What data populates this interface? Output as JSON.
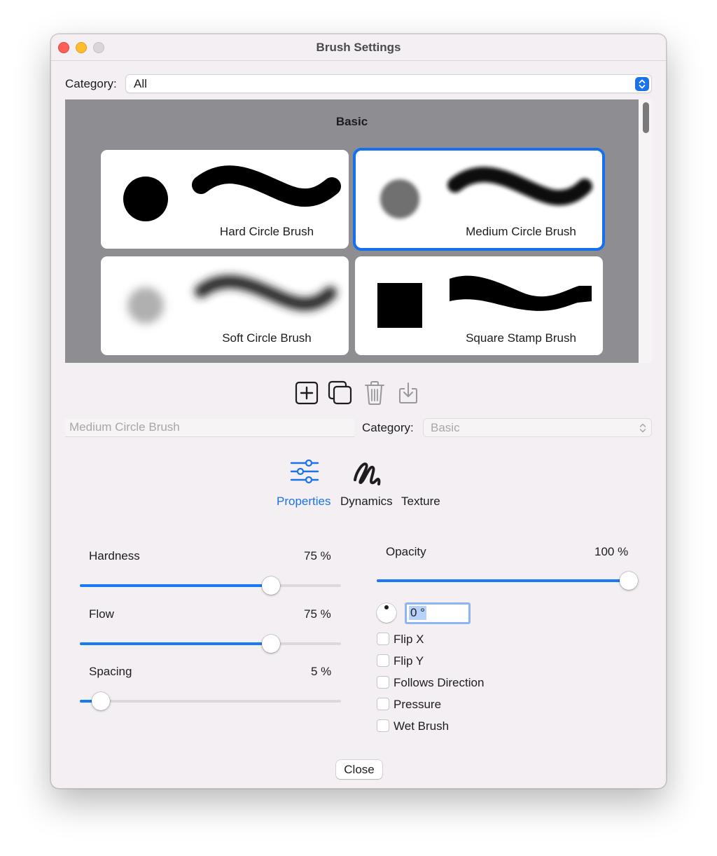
{
  "window": {
    "title": "Brush Settings"
  },
  "filter": {
    "label": "Category:",
    "value": "All"
  },
  "gallery": {
    "section": "Basic",
    "brushes": [
      {
        "name": "Hard Circle Brush",
        "selected": false
      },
      {
        "name": "Medium Circle Brush",
        "selected": true
      },
      {
        "name": "Soft Circle Brush",
        "selected": false
      },
      {
        "name": "Square Stamp Brush",
        "selected": false
      }
    ]
  },
  "toolbar": {
    "icons": [
      "add-icon",
      "duplicate-icon",
      "trash-icon",
      "import-icon"
    ]
  },
  "editor": {
    "name_placeholder": "Medium Circle Brush",
    "category_label": "Category:",
    "category_value": "Basic"
  },
  "tabs": [
    {
      "label": "Properties",
      "active": true,
      "icon": "sliders-icon"
    },
    {
      "label": "Dynamics",
      "active": false,
      "icon": "scribble-icon"
    },
    {
      "label": "Texture",
      "active": false
    }
  ],
  "sliders": {
    "hardness": {
      "label": "Hardness",
      "value_text": "75 %",
      "value": 75
    },
    "flow": {
      "label": "Flow",
      "value_text": "75 %",
      "value": 75
    },
    "spacing": {
      "label": "Spacing",
      "value_text": "5 %",
      "value": 5
    },
    "opacity": {
      "label": "Opacity",
      "value_text": "100 %",
      "value": 100
    }
  },
  "angle": {
    "value": "0 °"
  },
  "checkboxes": [
    {
      "label": "Flip X",
      "checked": false
    },
    {
      "label": "Flip Y",
      "checked": false
    },
    {
      "label": "Follows Direction",
      "checked": false
    },
    {
      "label": "Pressure",
      "checked": false
    },
    {
      "label": "Wet Brush",
      "checked": false
    }
  ],
  "buttons": {
    "close": "Close"
  },
  "colors": {
    "accent": "#1a73e8",
    "gallery_bg": "#8e8d92",
    "window_bg": "#f3eff2"
  }
}
